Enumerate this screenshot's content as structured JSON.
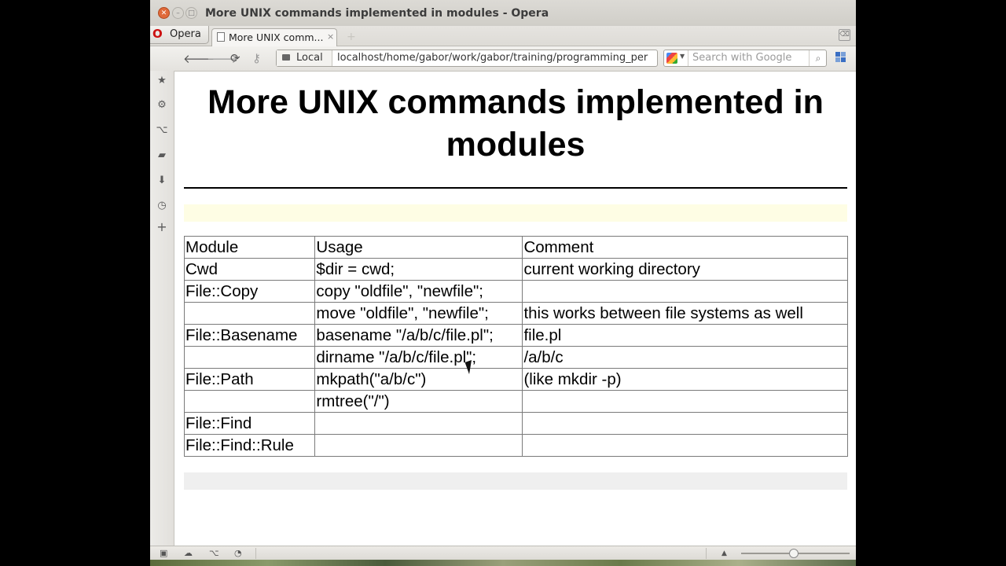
{
  "window": {
    "title": "More UNIX commands implemented in modules - Opera"
  },
  "tabbar": {
    "opera_label": "Opera",
    "active_tab_label": "More UNIX comm...",
    "close_glyph": "×",
    "new_tab_glyph": "+"
  },
  "navbar": {
    "security_label": "Local",
    "url": "localhost/home/gabor/work/gabor/training/programming_per",
    "search_placeholder": "Search with Google"
  },
  "sidebar": {
    "items": [
      "star-icon",
      "gear-icon",
      "share-icon",
      "note-icon",
      "download-icon",
      "clock-icon",
      "plus-icon"
    ]
  },
  "page": {
    "title": "More UNIX commands implemented in modules",
    "table": {
      "headers": [
        "Module",
        "Usage",
        "Comment"
      ],
      "rows": [
        [
          "Cwd",
          "$dir = cwd;",
          "current working directory"
        ],
        [
          "File::Copy",
          "copy \"oldfile\", \"newfile\";",
          ""
        ],
        [
          "",
          "move \"oldfile\", \"newfile\";",
          "this works between file systems as well"
        ],
        [
          "File::Basename",
          "basename \"/a/b/c/file.pl\";",
          "file.pl"
        ],
        [
          "",
          "dirname \"/a/b/c/file.pl\";",
          "/a/b/c"
        ],
        [
          "File::Path",
          "mkpath(\"a/b/c\")",
          "(like mkdir -p)"
        ],
        [
          "",
          "rmtree(\"/\")",
          ""
        ],
        [
          "File::Find",
          "",
          ""
        ],
        [
          "File::Find::Rule",
          "",
          ""
        ]
      ]
    }
  },
  "colors": {
    "yellow_band": "#fefde4",
    "gray_band": "#efefef",
    "close_button": "#e06a3a",
    "opera_red": "#cc1111"
  }
}
